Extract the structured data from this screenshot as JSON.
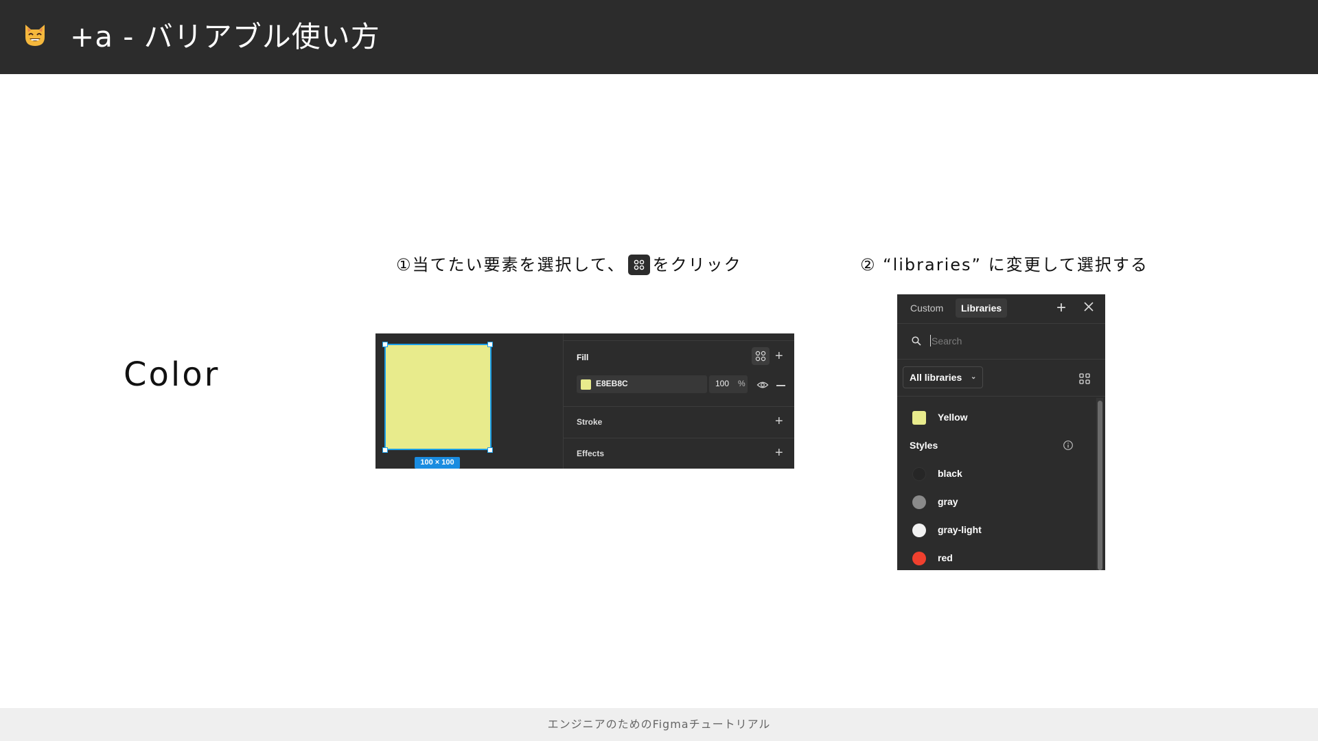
{
  "header": {
    "title": "+a - バリアブル使い方",
    "icon": "smiling-cat-icon"
  },
  "section_label": "Color",
  "steps": {
    "step1_prefix": "①当てたい要素を選択して、",
    "step1_suffix": "をクリック",
    "step2": "② “libraries” に変更して選択する"
  },
  "fill_panel": {
    "canvas": {
      "size_badge": "100 × 100",
      "fill_color": "#E8EB8C"
    },
    "fill_label": "Fill",
    "hex_value": "E8EB8C",
    "opacity_value": "100",
    "opacity_unit": "%",
    "stroke_label": "Stroke",
    "effects_label": "Effects"
  },
  "library_panel": {
    "tabs": [
      "Custom",
      "Libraries"
    ],
    "active_tab": "Libraries",
    "search_placeholder": "Search",
    "library_select": "All libraries",
    "variables": [
      {
        "label": "Yellow",
        "color": "#E8EB8C"
      }
    ],
    "styles_heading": "Styles",
    "styles": [
      {
        "label": "black",
        "color": "#262626"
      },
      {
        "label": "gray",
        "color": "#8a8a8a"
      },
      {
        "label": "gray-light",
        "color": "#f2f2f2"
      },
      {
        "label": "red",
        "color": "#f0402e"
      }
    ]
  },
  "footer": {
    "text": "エンジニアのためのFigmaチュートリアル"
  }
}
